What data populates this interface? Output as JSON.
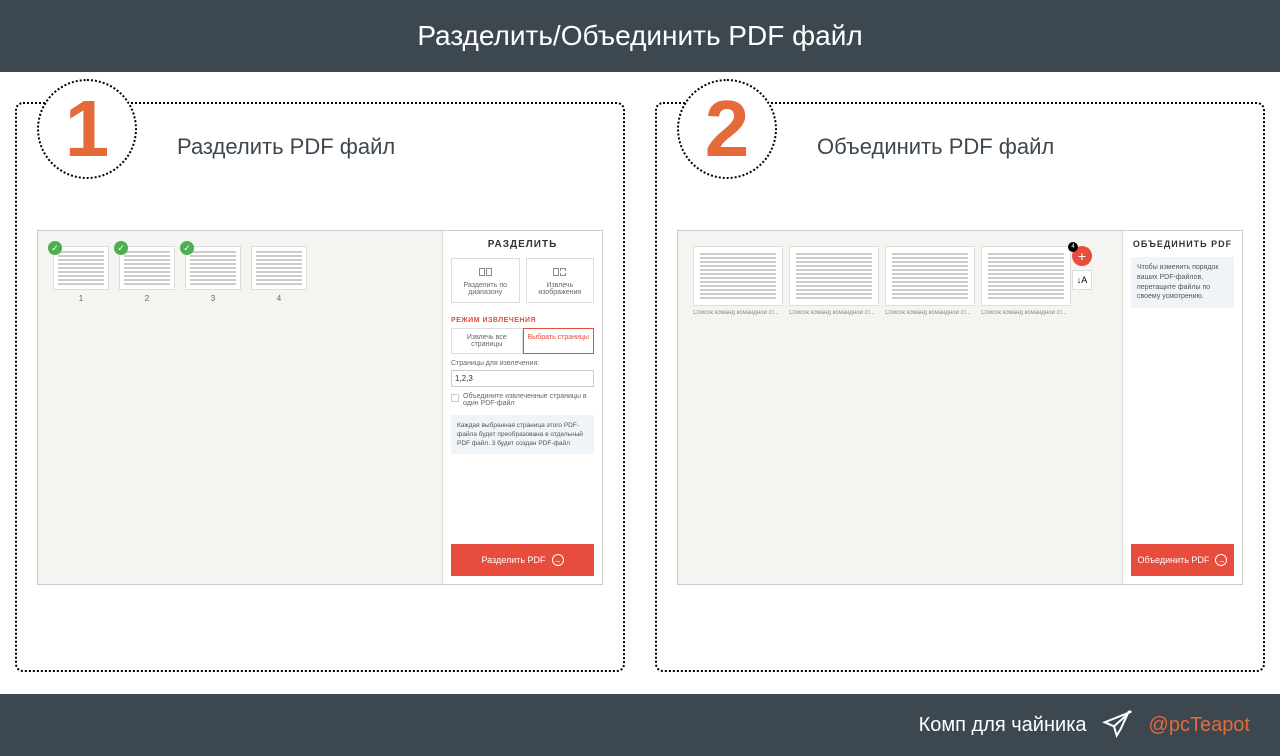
{
  "header": {
    "title": "Разделить/Объединить PDF файл"
  },
  "panels": {
    "left": {
      "num": "1",
      "title": "Разделить PDF файл",
      "sidebar_title": "РАЗДЕЛИТЬ",
      "mode1": "Разделить по диапазону",
      "mode2": "Извлечь изображения",
      "section": "РЕЖИМ ИЗВЛЕЧЕНИЯ",
      "tab1": "Извлечь все страницы",
      "tab2": "Выбрать страницы",
      "input_label": "Страницы для извлечения:",
      "input_value": "1,2,3",
      "checkbox": "Объедините извлеченные страницы в один PDF-файл",
      "info": "Каждая выбранная страница этого PDF-файла будет преобразована в отдельный PDF файл. 3 будет создан PDF-файл",
      "button": "Разделить PDF",
      "thumbs": [
        "1",
        "2",
        "3",
        "4"
      ]
    },
    "right": {
      "num": "2",
      "title": "Объединить PDF файл",
      "sidebar_title": "ОБЪЕДИНИТЬ PDF",
      "info": "Чтобы изменить порядок ваших PDF-файлов, перетащите файлы по своему усмотрению.",
      "button": "Объединить PDF",
      "caption": "Список команд командной ст...",
      "add_count": "4"
    }
  },
  "footer": {
    "text": "Комп для чайника",
    "handle": "@pcTeapot"
  }
}
